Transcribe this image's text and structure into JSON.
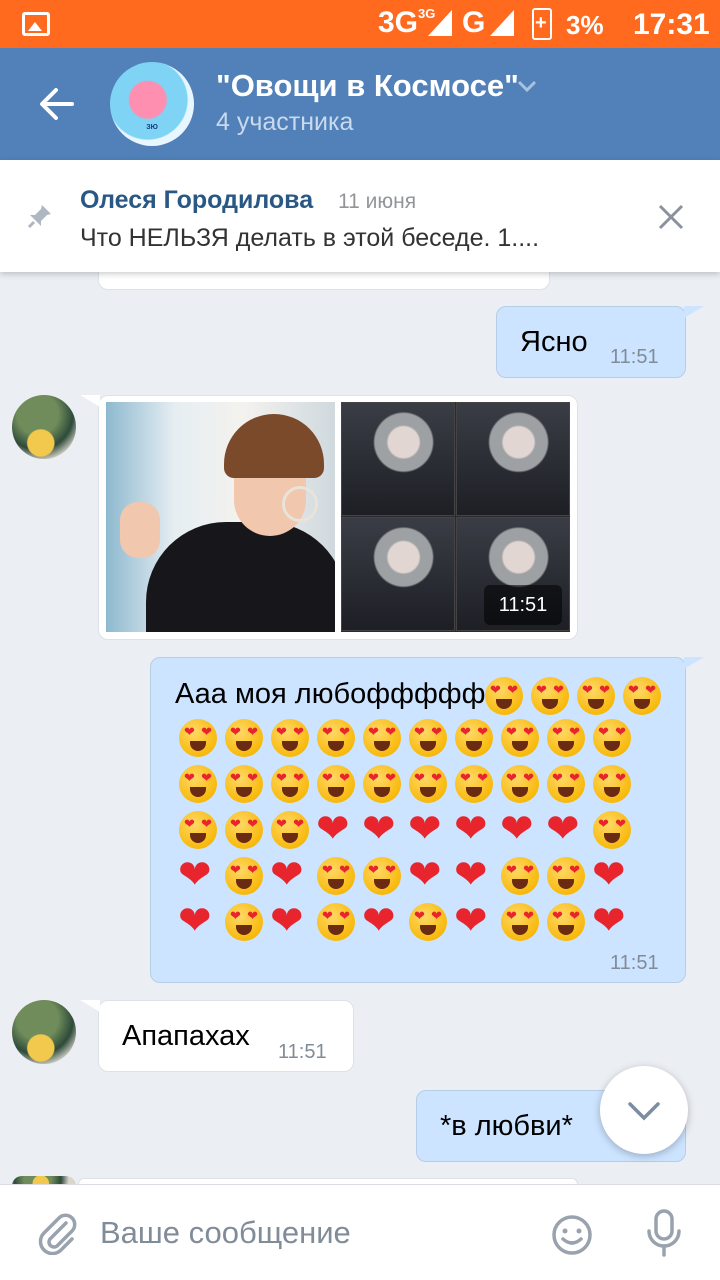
{
  "status_bar": {
    "network1": "3G",
    "network1_sup": "3G",
    "network2": "G",
    "battery": "3%",
    "time": "17:31"
  },
  "header": {
    "title": "\"Овощи в Космосе\"",
    "subtitle": "4 участника",
    "avatar_caption": "ЗЮ"
  },
  "pinned": {
    "author": "Олеся Городилова",
    "date": "11 июня",
    "text": "Что НЕЛЬЗЯ делать в этой беседе. 1...."
  },
  "messages": [
    {
      "dir": "out",
      "text": "Ясно",
      "time": "11:51"
    },
    {
      "dir": "in",
      "type": "photos",
      "time": "11:51"
    },
    {
      "dir": "out",
      "text": "Ааа моя любоффффф",
      "time": "11:51"
    },
    {
      "dir": "in",
      "text": "Апапахах",
      "time": "11:51"
    },
    {
      "dir": "out",
      "text": "*в любви*"
    }
  ],
  "emoji_rows": [
    [
      "face",
      "face",
      "face",
      "face"
    ],
    [
      "face",
      "face",
      "face",
      "face",
      "face",
      "face",
      "face",
      "face",
      "face",
      "face"
    ],
    [
      "face",
      "face",
      "face",
      "face",
      "face",
      "face",
      "face",
      "face",
      "face",
      "face"
    ],
    [
      "face",
      "face",
      "face",
      "heart",
      "heart",
      "heart",
      "heart",
      "heart",
      "heart",
      "face"
    ],
    [
      "heart",
      "face",
      "heart",
      "face",
      "face",
      "heart",
      "heart",
      "face",
      "face",
      "heart"
    ],
    [
      "heart",
      "face",
      "heart",
      "face",
      "heart",
      "face",
      "heart",
      "face",
      "face",
      "heart"
    ]
  ],
  "input": {
    "placeholder": "Ваше сообщение"
  },
  "colors": {
    "status_bar": "#ff6a1f",
    "header": "#5181b8",
    "outgoing": "#cce4ff",
    "incoming": "#ffffff",
    "link": "#2a5885"
  },
  "icons": [
    "back-arrow-icon",
    "chevron-down-icon",
    "pin-icon",
    "close-icon",
    "chevron-down-icon",
    "paperclip-icon",
    "smile-icon",
    "mic-icon"
  ]
}
